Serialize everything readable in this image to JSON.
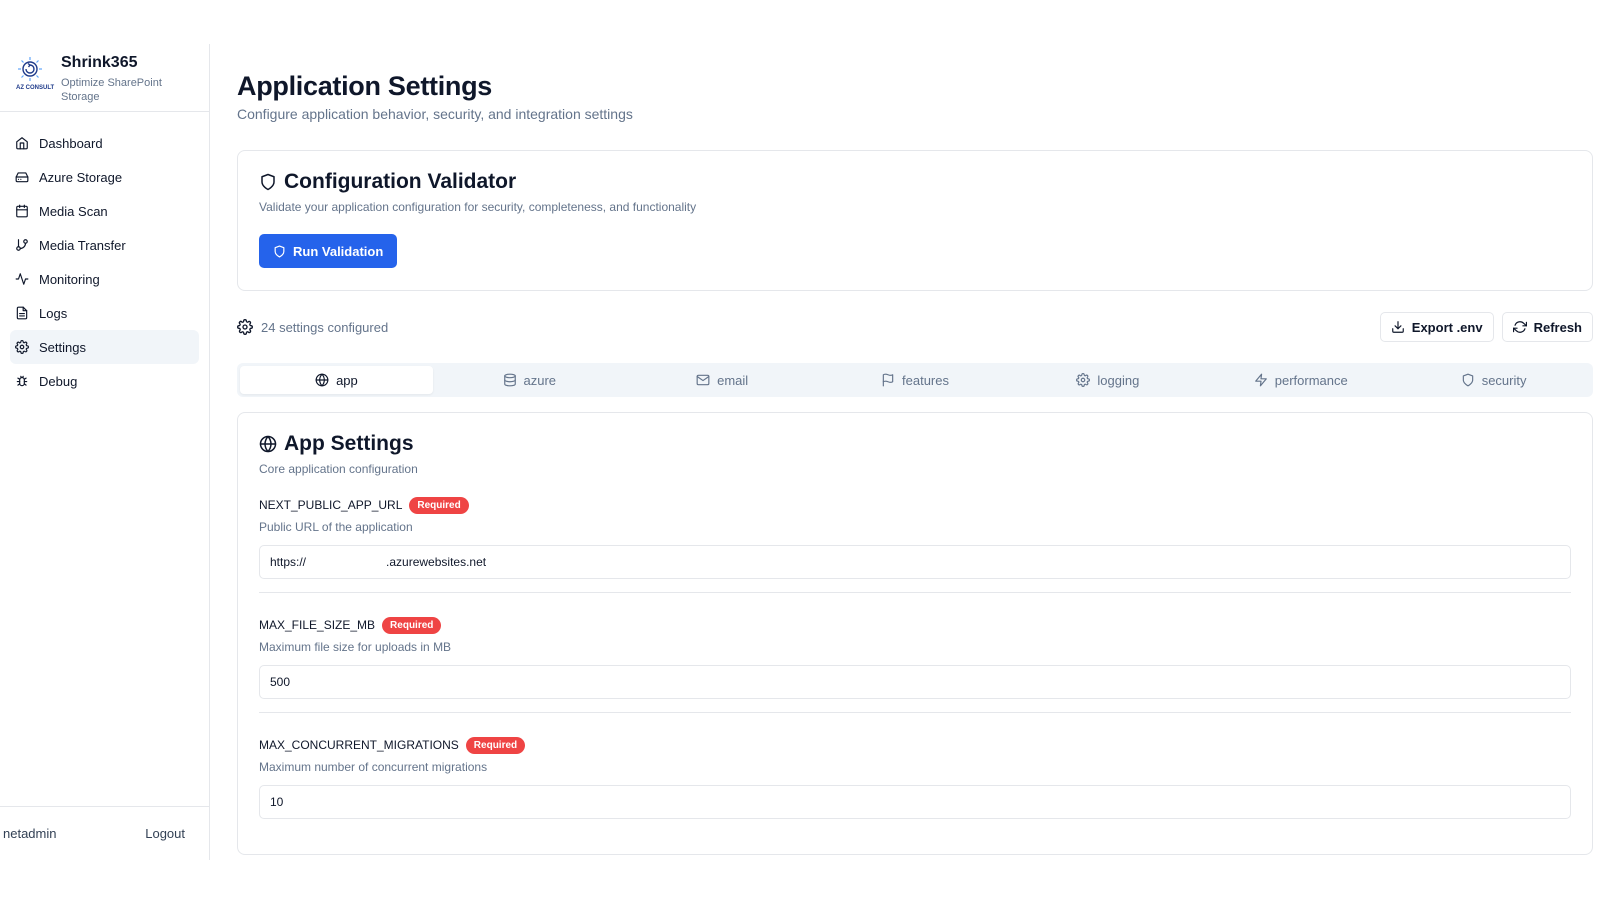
{
  "brand": {
    "name": "Shrink365",
    "subtitle": "Optimize SharePoint Storage",
    "logo_text": "AZ CONSULT"
  },
  "sidebar": {
    "items": [
      {
        "label": "Dashboard",
        "icon": "home-icon"
      },
      {
        "label": "Azure Storage",
        "icon": "hard-drive-icon"
      },
      {
        "label": "Media Scan",
        "icon": "calendar-icon"
      },
      {
        "label": "Media Transfer",
        "icon": "git-branch-icon"
      },
      {
        "label": "Monitoring",
        "icon": "activity-icon"
      },
      {
        "label": "Logs",
        "icon": "file-text-icon"
      },
      {
        "label": "Settings",
        "icon": "gear-icon",
        "active": true
      },
      {
        "label": "Debug",
        "icon": "bug-icon"
      }
    ],
    "user": "netadmin",
    "logout": "Logout"
  },
  "page": {
    "title": "Application Settings",
    "subtitle": "Configure application behavior, security, and integration settings"
  },
  "validator": {
    "title": "Configuration Validator",
    "description": "Validate your application configuration for security, completeness, and functionality",
    "button": "Run Validation"
  },
  "toolbar": {
    "count": "24 settings configured",
    "export": "Export .env",
    "refresh": "Refresh"
  },
  "tabs": [
    {
      "label": "app",
      "icon": "globe-icon",
      "active": true
    },
    {
      "label": "azure",
      "icon": "database-icon"
    },
    {
      "label": "email",
      "icon": "mail-icon"
    },
    {
      "label": "features",
      "icon": "flag-icon"
    },
    {
      "label": "logging",
      "icon": "gear-icon"
    },
    {
      "label": "performance",
      "icon": "zap-icon"
    },
    {
      "label": "security",
      "icon": "shield-icon"
    }
  ],
  "app_settings": {
    "title": "App Settings",
    "description": "Core application configuration",
    "fields": [
      {
        "name": "NEXT_PUBLIC_APP_URL",
        "badge": "Required",
        "description": "Public URL of the application",
        "value": "https://                        .azurewebsites.net"
      },
      {
        "name": "MAX_FILE_SIZE_MB",
        "badge": "Required",
        "description": "Maximum file size for uploads in MB",
        "value": "500"
      },
      {
        "name": "MAX_CONCURRENT_MIGRATIONS",
        "badge": "Required",
        "description": "Maximum number of concurrent migrations",
        "value": "10"
      }
    ]
  },
  "colors": {
    "primary": "#2563eb",
    "required_badge": "#ef4444",
    "active_nav_bg": "#f1f5f9",
    "muted_text": "#64748b"
  }
}
